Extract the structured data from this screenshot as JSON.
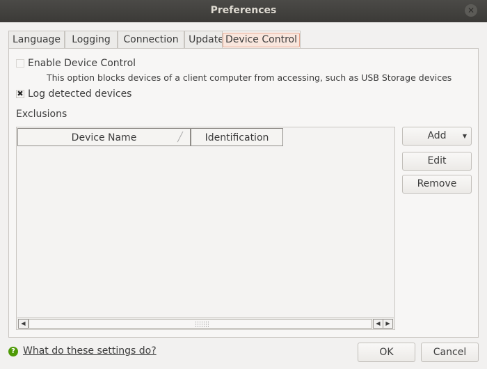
{
  "window": {
    "title": "Preferences"
  },
  "tabs": [
    {
      "label": "Language"
    },
    {
      "label": "Logging"
    },
    {
      "label": "Connection"
    },
    {
      "label": "Update"
    },
    {
      "label": "Device Control",
      "active": true
    }
  ],
  "device_control": {
    "enable_label": "Enable Device Control",
    "enable_checked": false,
    "enable_disabled": true,
    "enable_desc": "This option blocks devices of a client computer from accessing, such as USB Storage devices",
    "log_label": "Log detected devices",
    "log_checked": true
  },
  "exclusions": {
    "label": "Exclusions",
    "columns": [
      "Device Name",
      "Identification"
    ],
    "rows": []
  },
  "side_buttons": {
    "add": "Add",
    "edit": "Edit",
    "remove": "Remove"
  },
  "footer": {
    "help_text": "What do these settings do?",
    "ok": "OK",
    "cancel": "Cancel"
  }
}
